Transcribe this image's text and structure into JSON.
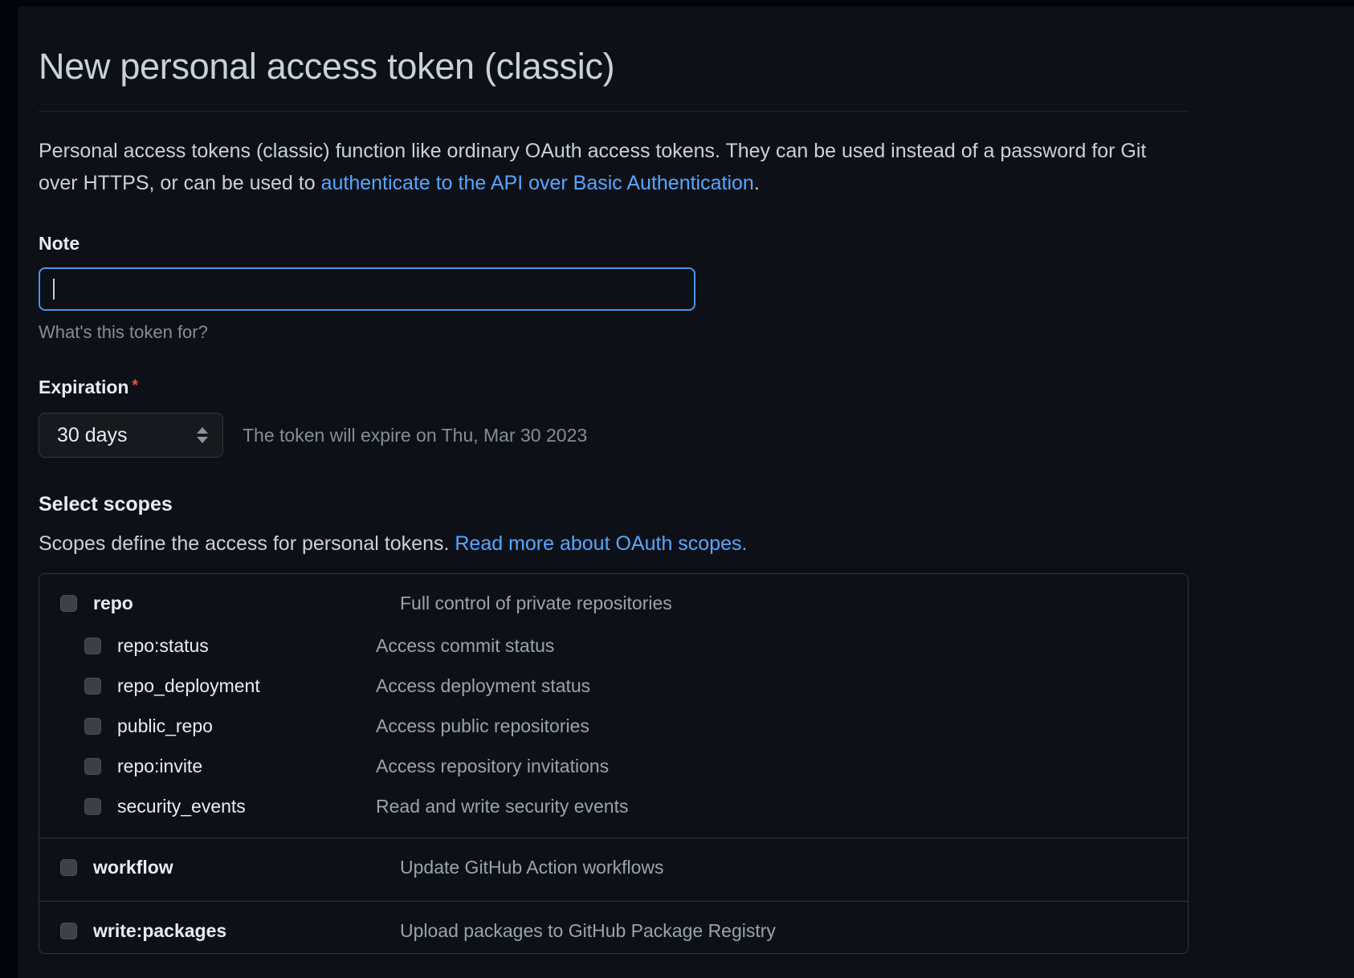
{
  "page": {
    "title": "New personal access token (classic)",
    "description_part1": "Personal access tokens (classic) function like ordinary OAuth access tokens. They can be used instead of a password for Git over HTTPS, or can be used to ",
    "description_link": "authenticate to the API over Basic Authentication",
    "description_part2": "."
  },
  "note": {
    "label": "Note",
    "value": "",
    "placeholder": "",
    "hint": "What's this token for?"
  },
  "expiration": {
    "label": "Expiration",
    "required_marker": "*",
    "selected": "30 days",
    "expire_note": "The token will expire on Thu, Mar 30 2023"
  },
  "scopes": {
    "heading": "Select scopes",
    "description_text": "Scopes define the access for personal tokens. ",
    "description_link": "Read more about OAuth scopes.",
    "groups": [
      {
        "name": "repo",
        "description": "Full control of private repositories",
        "checked": false,
        "children": [
          {
            "name": "repo:status",
            "description": "Access commit status",
            "checked": false
          },
          {
            "name": "repo_deployment",
            "description": "Access deployment status",
            "checked": false
          },
          {
            "name": "public_repo",
            "description": "Access public repositories",
            "checked": false
          },
          {
            "name": "repo:invite",
            "description": "Access repository invitations",
            "checked": false
          },
          {
            "name": "security_events",
            "description": "Read and write security events",
            "checked": false
          }
        ]
      },
      {
        "name": "workflow",
        "description": "Update GitHub Action workflows",
        "checked": false,
        "children": []
      },
      {
        "name": "write:packages",
        "description": "Upload packages to GitHub Package Registry",
        "checked": false,
        "children": []
      }
    ]
  },
  "colors": {
    "background": "#0d1117",
    "text": "#c9d1d9",
    "link": "#58a6ff",
    "required": "#f85149",
    "focus_border": "#4b93e8",
    "border": "#30363d"
  }
}
